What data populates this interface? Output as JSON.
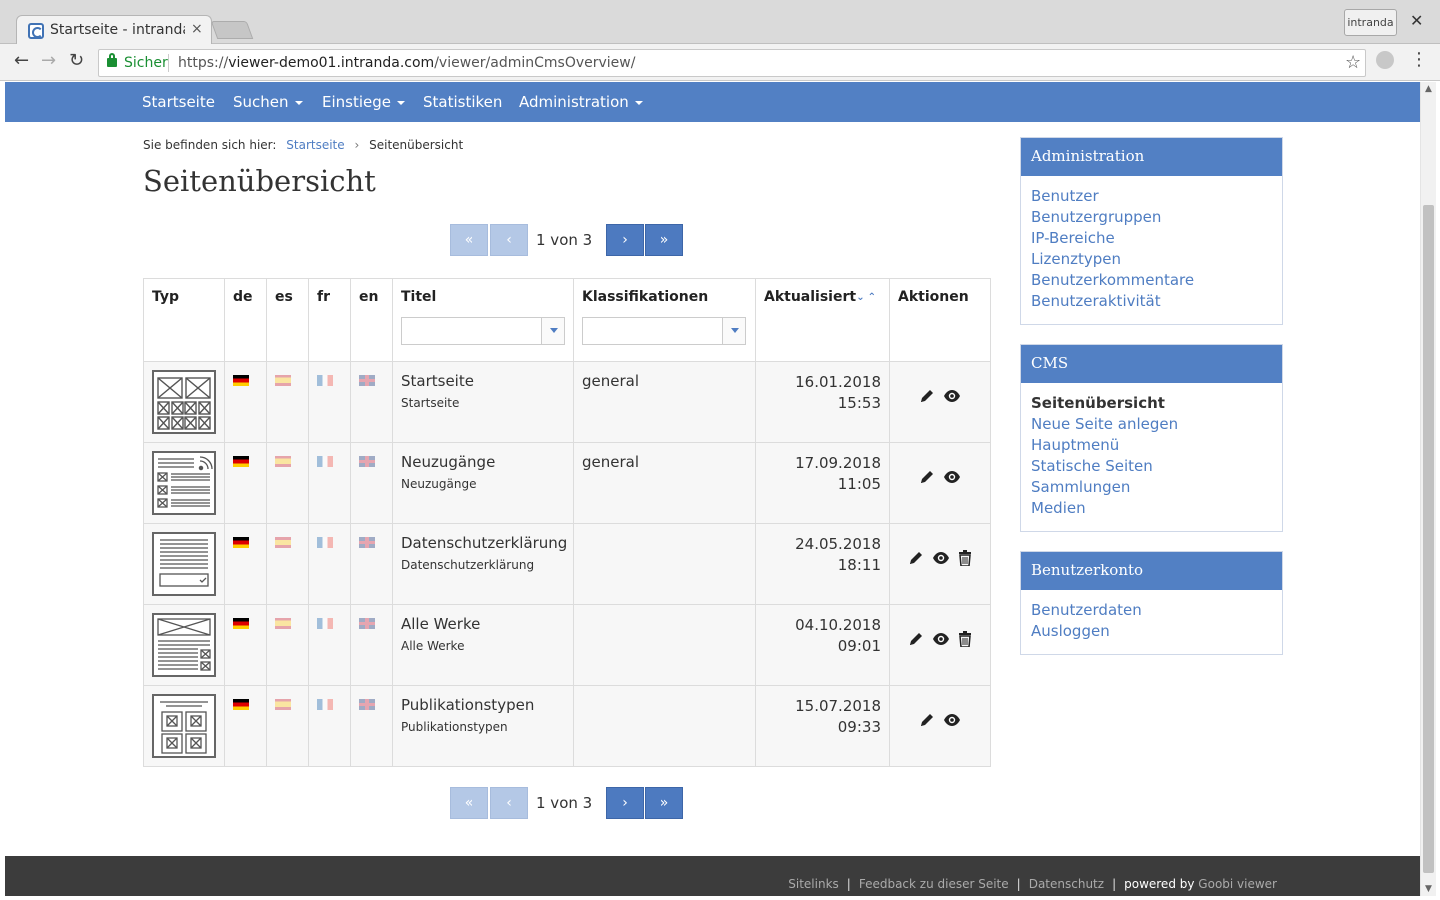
{
  "browser": {
    "tab_title": "Startseite - intranda",
    "tab_close": "×",
    "profile": "intranda",
    "window_close": "✕",
    "secure_label": "Sicher",
    "url_scheme": "https://",
    "url_host": "viewer-demo01.intranda.com",
    "url_path": "/viewer/adminCmsOverview/",
    "back": "←",
    "forward": "→",
    "reload": "↻",
    "star": "☆",
    "menu": "⋮"
  },
  "nav": {
    "items": [
      {
        "label": "Startseite",
        "dropdown": false
      },
      {
        "label": "Suchen",
        "dropdown": true
      },
      {
        "label": "Einstiege",
        "dropdown": true
      },
      {
        "label": "Statistiken",
        "dropdown": false
      },
      {
        "label": "Administration",
        "dropdown": true
      }
    ]
  },
  "breadcrumb": {
    "prefix": "Sie befinden sich hier:",
    "home": "Startseite",
    "separator": "›",
    "current": "Seitenübersicht"
  },
  "page_title": "Seitenübersicht",
  "pager": {
    "first": "«",
    "prev": "‹",
    "next": "›",
    "last": "»",
    "text": "1 von 3"
  },
  "table": {
    "headers": {
      "typ": "Typ",
      "de": "de",
      "es": "es",
      "fr": "fr",
      "en": "en",
      "titel": "Titel",
      "klassifikationen": "Klassifikationen",
      "aktualisiert": "Aktualisiert",
      "aktionen": "Aktionen"
    },
    "sort_icon": "⌄⌃",
    "rows": [
      {
        "template": "grid-images",
        "title": "Startseite",
        "subtitle": "Startseite",
        "classification": "general",
        "date": "16.01.2018",
        "time": "15:53",
        "deletable": false
      },
      {
        "template": "rss-list",
        "title": "Neuzugänge",
        "subtitle": "Neuzugänge",
        "classification": "general",
        "date": "17.09.2018",
        "time": "11:05",
        "deletable": false
      },
      {
        "template": "text-form",
        "title": "Datenschutzerklärung",
        "subtitle": "Datenschutzerklärung",
        "classification": "",
        "date": "24.05.2018",
        "time": "18:11",
        "deletable": true
      },
      {
        "template": "banner-text",
        "title": "Alle Werke",
        "subtitle": "Alle Werke",
        "classification": "",
        "date": "04.10.2018",
        "time": "09:01",
        "deletable": true
      },
      {
        "template": "tiles",
        "title": "Publikationstypen",
        "subtitle": "Publikationstypen",
        "classification": "",
        "date": "15.07.2018",
        "time": "09:33",
        "deletable": false
      }
    ]
  },
  "sidebar": {
    "admin": {
      "title": "Administration",
      "links": [
        "Benutzer",
        "Benutzergruppen",
        "IP-Bereiche",
        "Lizenztypen",
        "Benutzerkommentare",
        "Benutzeraktivität"
      ]
    },
    "cms": {
      "title": "CMS",
      "active": "Seitenübersicht",
      "links": [
        "Neue Seite anlegen",
        "Hauptmenü",
        "Statische Seiten",
        "Sammlungen",
        "Medien"
      ]
    },
    "account": {
      "title": "Benutzerkonto",
      "links": [
        "Benutzerdaten",
        "Ausloggen"
      ]
    }
  },
  "footer": {
    "sitelinks": "Sitelinks",
    "feedback": "Feedback zu dieser Seite",
    "datenschutz": "Datenschutz",
    "powered": "powered by",
    "brand": "Goobi viewer",
    "separator": "|"
  },
  "colors": {
    "primary": "#5280c4",
    "link": "#4f7dc2",
    "footer": "#3c3c3c",
    "secure": "#1a8f33"
  }
}
